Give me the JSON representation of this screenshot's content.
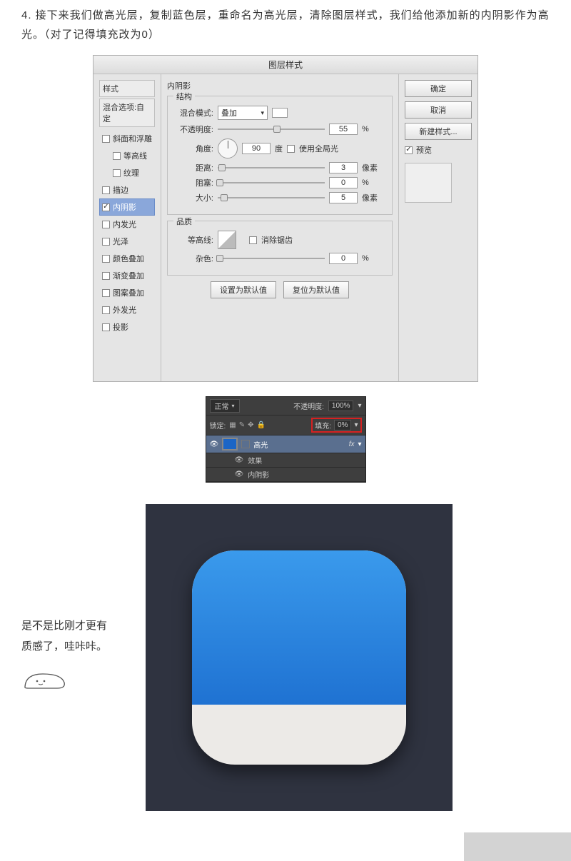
{
  "intro": "4. 接下来我们做高光层，复制蓝色层，重命名为高光层，清除图层样式，我们给他添加新的内阴影作为高光。（对了记得填充改为0）",
  "dialog": {
    "title": "图层样式",
    "left": {
      "header": "样式",
      "subheader": "混合选项:自定",
      "items": [
        {
          "label": "斜面和浮雕",
          "checked": false,
          "sub": false
        },
        {
          "label": "等高线",
          "checked": false,
          "sub": true
        },
        {
          "label": "纹理",
          "checked": false,
          "sub": true
        },
        {
          "label": "描边",
          "checked": false,
          "sub": false
        },
        {
          "label": "内阴影",
          "checked": true,
          "sub": false,
          "selected": true
        },
        {
          "label": "内发光",
          "checked": false,
          "sub": false
        },
        {
          "label": "光泽",
          "checked": false,
          "sub": false
        },
        {
          "label": "颜色叠加",
          "checked": false,
          "sub": false
        },
        {
          "label": "渐变叠加",
          "checked": false,
          "sub": false
        },
        {
          "label": "图案叠加",
          "checked": false,
          "sub": false
        },
        {
          "label": "外发光",
          "checked": false,
          "sub": false
        },
        {
          "label": "投影",
          "checked": false,
          "sub": false
        }
      ]
    },
    "center": {
      "panel_title": "内阴影",
      "group1": "结构",
      "blend_label": "混合模式:",
      "blend_value": "叠加",
      "opacity_label": "不透明度:",
      "opacity_value": "55",
      "opacity_unit": "%",
      "angle_label": "角度:",
      "angle_value": "90",
      "angle_unit": "度",
      "global_label": "使用全局光",
      "distance_label": "距离:",
      "distance_value": "3",
      "distance_unit": "像素",
      "choke_label": "阻塞:",
      "choke_value": "0",
      "choke_unit": "%",
      "size_label": "大小:",
      "size_value": "5",
      "size_unit": "像素",
      "group2": "品质",
      "contour_label": "等高线:",
      "antialias_label": "消除锯齿",
      "noise_label": "杂色:",
      "noise_value": "0",
      "noise_unit": "%",
      "btn_default": "设置为默认值",
      "btn_reset": "复位为默认值"
    },
    "right": {
      "ok": "确定",
      "cancel": "取消",
      "new_style": "新建样式...",
      "preview_label": "预览"
    }
  },
  "layers": {
    "mode": "正常",
    "opacity_label": "不透明度:",
    "opacity_value": "100%",
    "lock_label": "锁定:",
    "fill_label": "填充:",
    "fill_value": "0%",
    "layer_name": "高光",
    "fx_label": "fx",
    "effects": "效果",
    "effect_item": "内阴影"
  },
  "commentary": {
    "line1": "是不是比刚才更有",
    "line2": "质感了，哇咔咔。"
  }
}
